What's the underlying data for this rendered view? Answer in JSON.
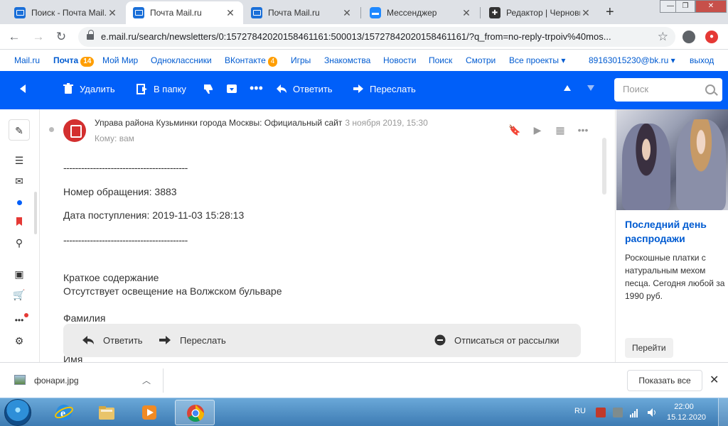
{
  "browser": {
    "tabs": [
      {
        "title": "Поиск - Почта Mail.ru",
        "icon": "mail-icon"
      },
      {
        "title": "Почта Mail.ru",
        "icon": "mail-icon",
        "active": true
      },
      {
        "title": "Почта Mail.ru",
        "icon": "mail-icon"
      },
      {
        "title": "Мессенджер",
        "icon": "messenger-icon"
      },
      {
        "title": "Редактор | Черновик",
        "icon": "editor-icon"
      }
    ],
    "new_tab_label": "+",
    "url": "e.mail.ru/search/newsletters/0:15727842020158461161:500013/15727842020158461161/?q_from=no-reply-trpoiv%40mos..."
  },
  "portal": {
    "links": [
      {
        "label": "Mail.ru"
      },
      {
        "label": "Почта",
        "badge": "14",
        "bold": true
      },
      {
        "label": "Мой Мир"
      },
      {
        "label": "Одноклассники"
      },
      {
        "label": "ВКонтакте",
        "badge": "4"
      },
      {
        "label": "Игры"
      },
      {
        "label": "Знакомства"
      },
      {
        "label": "Новости"
      },
      {
        "label": "Поиск"
      },
      {
        "label": "Смотри"
      },
      {
        "label": "Все проекты ▾"
      }
    ],
    "account": "89163015230@bk.ru ▾",
    "logout": "выход"
  },
  "toolbar": {
    "delete": "Удалить",
    "move_to_folder": "В папку",
    "reply": "Ответить",
    "forward": "Переслать",
    "search_placeholder": "Поиск"
  },
  "message": {
    "sender": "Управа района Кузьминки города Москвы: Официальный сайт",
    "date": "3 ноября 2019, 15:30",
    "recipient": "Кому: вам",
    "body": [
      "------------------------------------------",
      "Номер обращения: 3883",
      "Дата поступления: 2019-11-03 15:28:13",
      "------------------------------------------",
      "Краткое содержание",
      "Отсутствует освещение на Волжском бульваре",
      "Фамилия",
      "Имя"
    ]
  },
  "reply_bar": {
    "reply": "Ответить",
    "forward": "Переслать",
    "unsubscribe": "Отписаться от рассылки"
  },
  "ad": {
    "title": "Последний день распродажи",
    "text": "Роскошные платки с натуральным мехом песца. Сегодня любой за 1990 руб.",
    "button": "Перейти"
  },
  "downloads": {
    "file_name": "фонари.jpg",
    "show_all": "Показать все"
  },
  "taskbar": {
    "language": "RU",
    "time": "22:00",
    "date": "15.12.2020"
  },
  "colors": {
    "accent": "#005ff9",
    "link": "#005bd1",
    "badge": "#ff9e00"
  }
}
